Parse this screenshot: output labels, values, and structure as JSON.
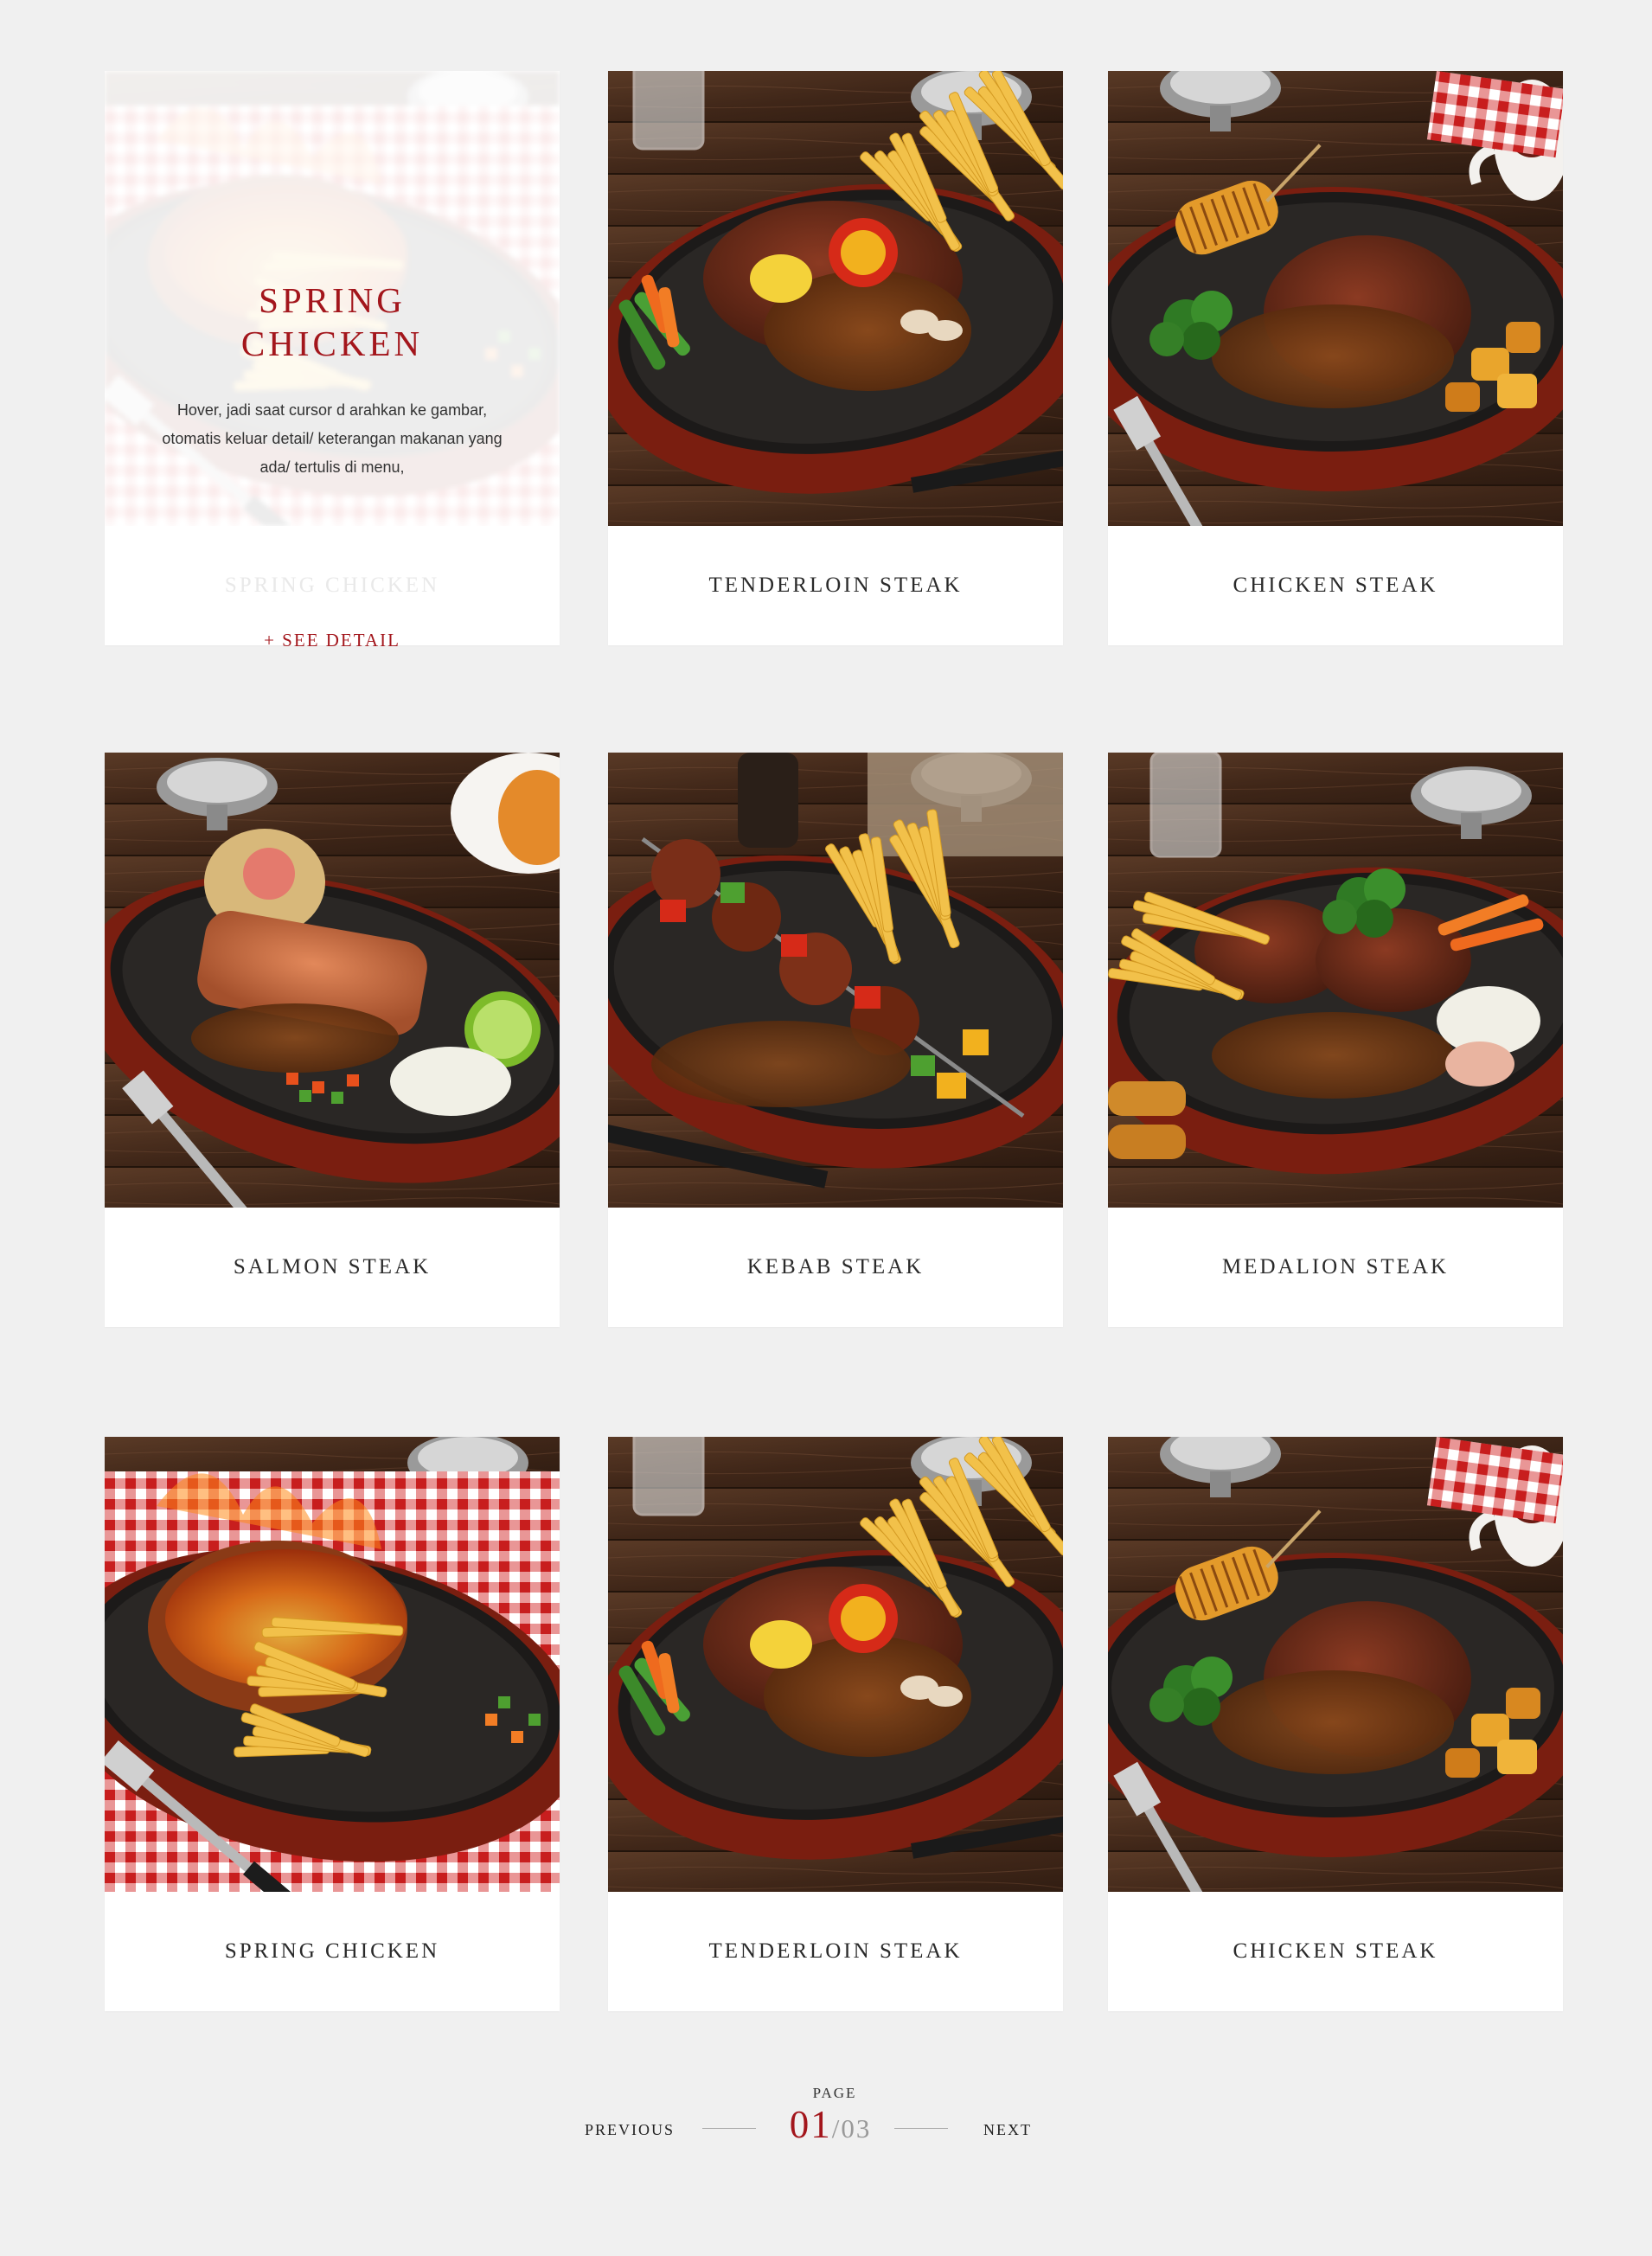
{
  "hover_card": {
    "title": "SPRING CHICKEN",
    "description": "Hover, jadi saat cursor d arahkan ke gambar, otomatis keluar detail/ keterangan makanan yang ada/ tertulis di menu,",
    "ghost_label": "SPRING CHICKEN",
    "action_label": "+ SEE DETAIL"
  },
  "menu_items": [
    {
      "label": "SPRING CHICKEN",
      "image": "spring-chicken-plate"
    },
    {
      "label": "TENDERLOIN STEAK",
      "image": "tenderloin-steak-plate"
    },
    {
      "label": "CHICKEN STEAK",
      "image": "chicken-steak-plate"
    },
    {
      "label": "SALMON STEAK",
      "image": "salmon-steak-plate"
    },
    {
      "label": "KEBAB STEAK",
      "image": "kebab-steak-plate"
    },
    {
      "label": "MEDALION STEAK",
      "image": "medalion-steak-plate"
    },
    {
      "label": "SPRING CHICKEN",
      "image": "spring-chicken-plate"
    },
    {
      "label": "TENDERLOIN STEAK",
      "image": "tenderloin-steak-plate"
    },
    {
      "label": "CHICKEN STEAK",
      "image": "chicken-steak-plate"
    }
  ],
  "pagination": {
    "page_label": "PAGE",
    "current": "01",
    "separator": "/",
    "total": "03",
    "previous_label": "PREVIOUS",
    "next_label": "NEXT"
  },
  "colors": {
    "accent": "#a3161c",
    "background": "#f0f0f0",
    "card": "#ffffff"
  }
}
